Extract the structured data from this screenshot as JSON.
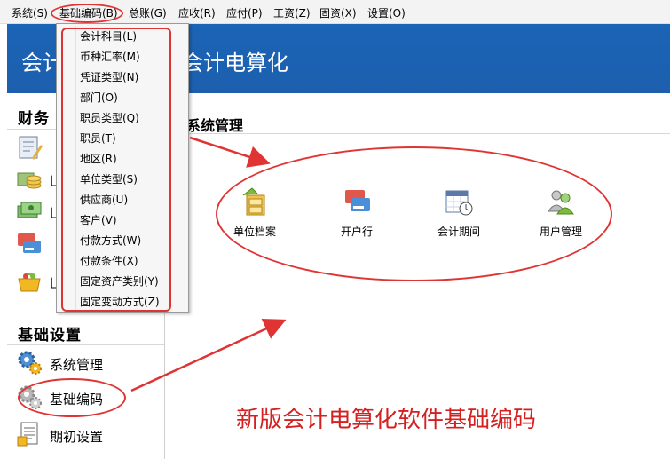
{
  "menubar": {
    "items": [
      "系统(S)",
      "基础编码(B)",
      "总账(G)",
      "应收(R)",
      "应付(P)",
      "工资(Z)",
      "固资(X)",
      "设置(O)"
    ]
  },
  "banner": {
    "title_left": "会计",
    "title_right": "会计电算化"
  },
  "sidebar": {
    "section_finance": "财务",
    "section_basic": "基础设置",
    "basic_items": [
      {
        "label": "系统管理",
        "icon": "gear-icon"
      },
      {
        "label": "基础编码",
        "icon": "gear-icon"
      },
      {
        "label": "期初设置",
        "icon": "document-icon"
      }
    ],
    "finance_icons": [
      "ledger-icon",
      "coins-icon",
      "cash-icon",
      "card-icon",
      "basket-icon"
    ],
    "finance_letters": [
      "",
      "凵",
      "凵",
      "",
      "凵"
    ]
  },
  "main": {
    "heading": "系统管理",
    "tools": [
      {
        "label": "单位档案",
        "icon": "cabinet-icon"
      },
      {
        "label": "开户行",
        "icon": "bank-card-icon"
      },
      {
        "label": "会计期间",
        "icon": "calendar-clock-icon"
      },
      {
        "label": "用户管理",
        "icon": "users-icon"
      }
    ]
  },
  "dropdown": {
    "items": [
      "会计科目(L)",
      "币种汇率(M)",
      "凭证类型(N)",
      "部门(O)",
      "职员类型(Q)",
      "职员(T)",
      "地区(R)",
      "单位类型(S)",
      "供应商(U)",
      "客户(V)",
      "付款方式(W)",
      "付款条件(X)",
      "固定资产类别(Y)",
      "固定变动方式(Z)"
    ]
  },
  "annotation": {
    "caption": "新版会计电算化软件基础编码"
  },
  "colors": {
    "banner": "#1d5fae",
    "annotation": "#e03434"
  }
}
